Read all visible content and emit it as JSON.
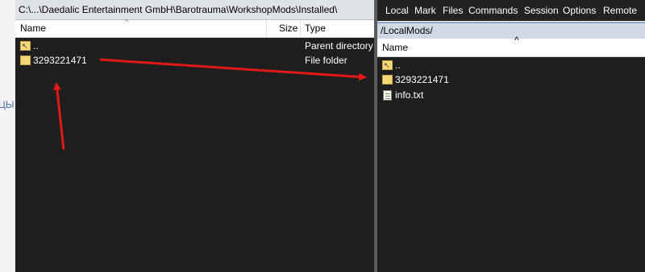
{
  "background_window": {
    "clipped_text": "ЦЫ"
  },
  "left_panel": {
    "path": "C:\\...\\Daedalic Entertainment GmbH\\Barotrauma\\WorkshopMods\\Installed\\",
    "columns": {
      "name": "Name",
      "size": "Size",
      "type": "Type"
    },
    "rows": [
      {
        "name": "..",
        "size": "",
        "type": "Parent directory"
      },
      {
        "name": "3293221471",
        "size": "",
        "type": "File folder"
      }
    ]
  },
  "right_panel": {
    "menu": [
      "Local",
      "Mark",
      "Files",
      "Commands",
      "Session",
      "Options",
      "Remote"
    ],
    "path": "/LocalMods/",
    "columns": {
      "name": "Name"
    },
    "rows": [
      {
        "name": "..",
        "icon": "parent-folder-icon"
      },
      {
        "name": "3293221471",
        "icon": "folder-icon"
      },
      {
        "name": "info.txt",
        "icon": "text-file-icon"
      }
    ]
  },
  "colors": {
    "annotation_arrow": "#e01818",
    "pane_bg": "#1e1e1e"
  }
}
